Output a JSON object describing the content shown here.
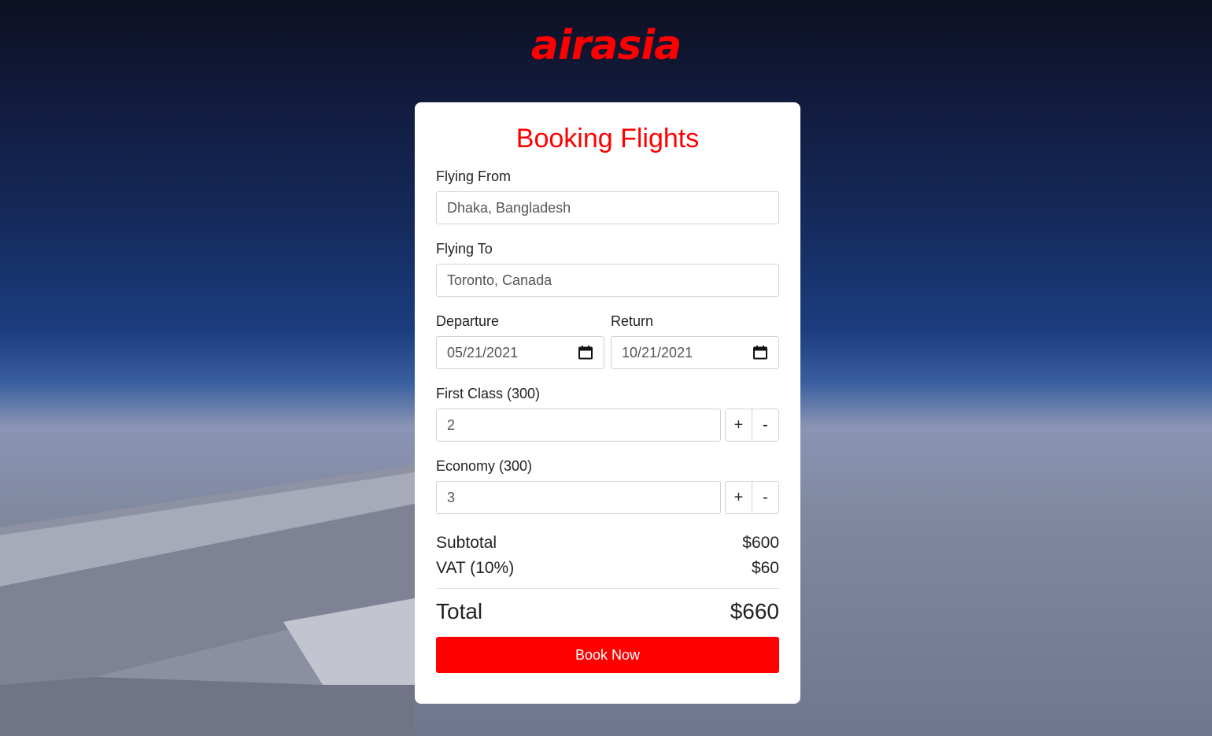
{
  "brand": {
    "logo_text": "airasia",
    "color": "#ff0000"
  },
  "form": {
    "title": "Booking Flights",
    "flying_from": {
      "label": "Flying From",
      "value": "Dhaka, Bangladesh"
    },
    "flying_to": {
      "label": "Flying To",
      "value": "Toronto, Canada"
    },
    "departure": {
      "label": "Departure",
      "value": "05/21/2021"
    },
    "return": {
      "label": "Return",
      "value": "10/21/2021"
    },
    "first_class": {
      "label": "First Class (300)",
      "value": "2",
      "plus": "+",
      "minus": "-"
    },
    "economy": {
      "label": "Economy (300)",
      "value": "3",
      "plus": "+",
      "minus": "-"
    },
    "icons": {
      "calendar": "calendar-icon"
    }
  },
  "summary": {
    "subtotal_label": "Subtotal",
    "subtotal_value": "$600",
    "vat_label": "VAT (10%)",
    "vat_value": "$60",
    "total_label": "Total",
    "total_value": "$660"
  },
  "action": {
    "book_label": "Book Now"
  }
}
